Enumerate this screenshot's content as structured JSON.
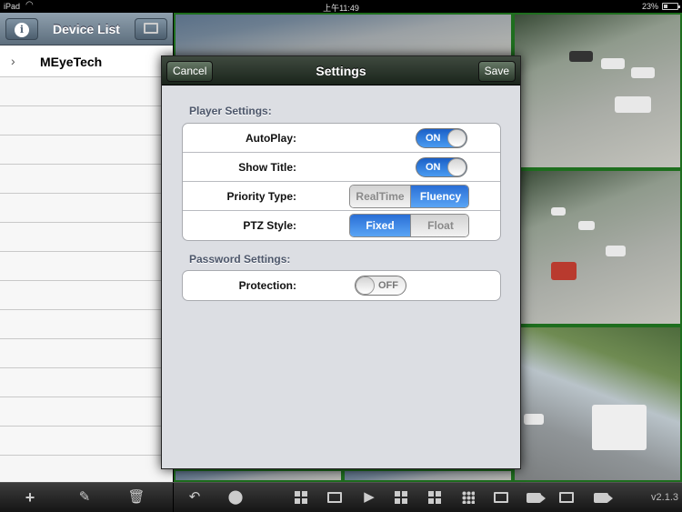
{
  "statusbar": {
    "device": "iPad",
    "time": "上午11:49",
    "battery": "23%",
    "battery_level": 0.23
  },
  "sidebar": {
    "title": "Device List",
    "info_label": "i",
    "devices": [
      {
        "name": "MEyeTech"
      }
    ]
  },
  "settings": {
    "title": "Settings",
    "cancel_label": "Cancel",
    "save_label": "Save",
    "player_section": "Player Settings:",
    "password_section": "Password Settings:",
    "rows": {
      "autoplay": {
        "label": "AutoPlay:",
        "state": "ON"
      },
      "show_title": {
        "label": "Show Title:",
        "state": "ON"
      },
      "priority_type": {
        "label": "Priority Type:",
        "options": [
          "RealTime",
          "Fluency"
        ],
        "selected": "Fluency"
      },
      "ptz_style": {
        "label": "PTZ Style:",
        "options": [
          "Fixed",
          "Float"
        ],
        "selected": "Fixed"
      },
      "protection": {
        "label": "Protection:",
        "state": "OFF"
      }
    }
  },
  "toolbar": {
    "version": "v2.1.3"
  }
}
